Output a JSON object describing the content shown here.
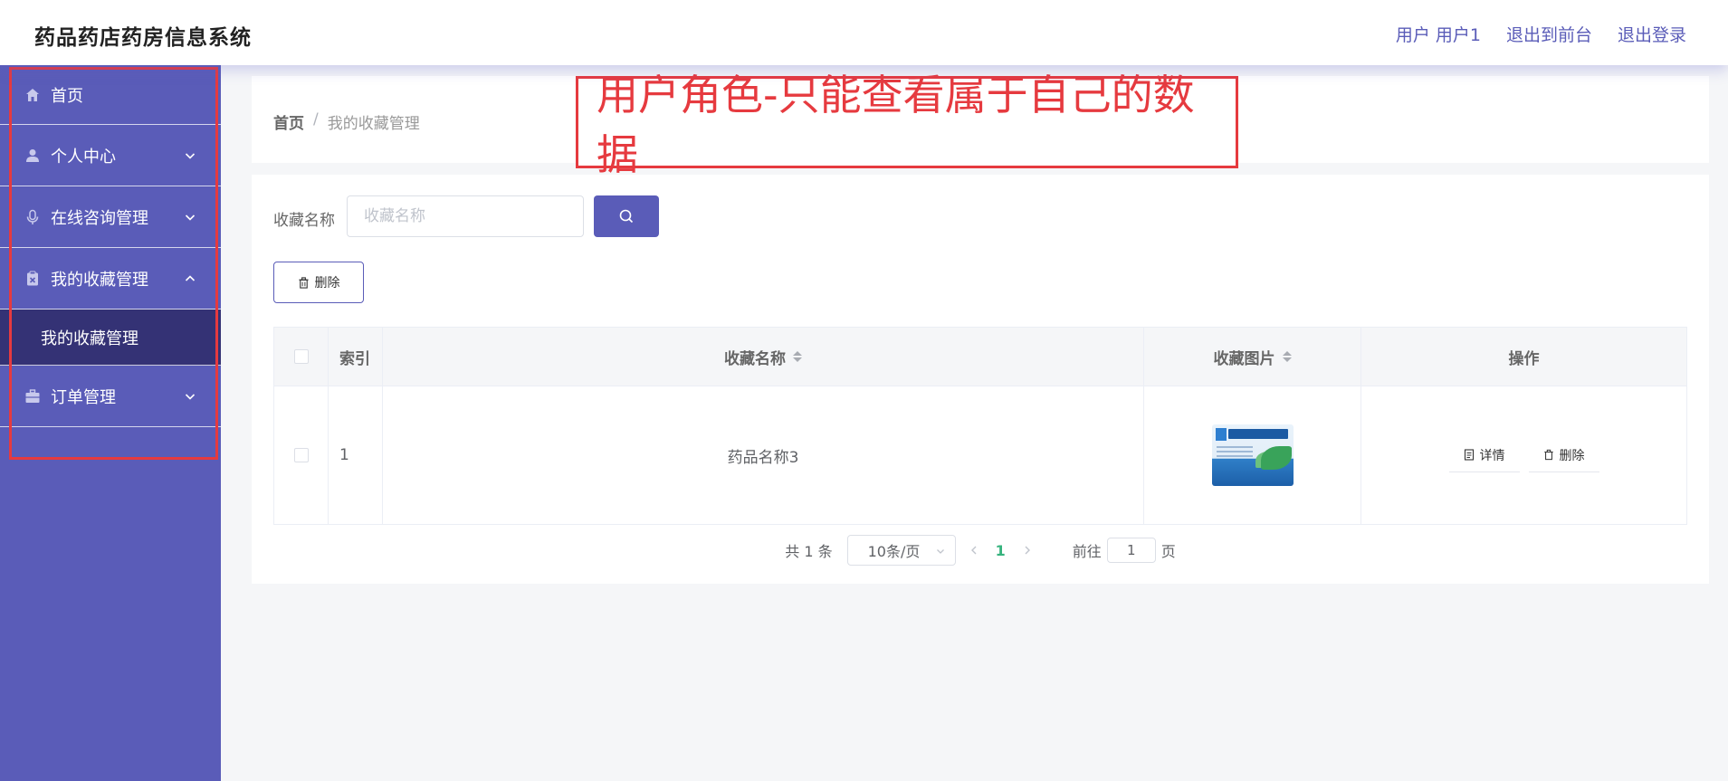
{
  "app": {
    "title": "药品药店药房信息系统"
  },
  "header": {
    "user_label": "用户 用户1",
    "to_front": "退出到前台",
    "logout": "退出登录"
  },
  "sidebar": {
    "items": [
      {
        "label": "首页",
        "icon": "home-icon"
      },
      {
        "label": "个人中心",
        "icon": "user-icon",
        "expandable": true,
        "expanded": false
      },
      {
        "label": "在线咨询管理",
        "icon": "microphone-icon",
        "expandable": true,
        "expanded": false
      },
      {
        "label": "我的收藏管理",
        "icon": "clipboard-icon",
        "expandable": true,
        "expanded": true
      },
      {
        "label": "订单管理",
        "icon": "briefcase-icon",
        "expandable": true,
        "expanded": false
      }
    ],
    "submenu": {
      "label": "我的收藏管理"
    }
  },
  "breadcrumb": {
    "home": "首页",
    "separator": "/",
    "current": "我的收藏管理"
  },
  "annotation": {
    "text": "用户角色-只能查看属于自己的数据"
  },
  "search": {
    "label": "收藏名称",
    "placeholder": "收藏名称",
    "value": ""
  },
  "actions": {
    "delete_label": "删除"
  },
  "table": {
    "columns": [
      "索引",
      "收藏名称",
      "收藏图片",
      "操作"
    ],
    "rows": [
      {
        "index": "1",
        "name": "药品名称3",
        "detail_label": "详情",
        "delete_label": "删除"
      }
    ]
  },
  "pagination": {
    "total_text": "共 1 条",
    "page_size": "10条/页",
    "current_page": "1",
    "goto_prefix": "前往",
    "goto_value": "1",
    "goto_suffix": "页"
  },
  "colors": {
    "primary": "#5a5cb8",
    "sidebar_active": "#343275",
    "annotation": "#e63a3f",
    "page_active": "#36b37e"
  }
}
